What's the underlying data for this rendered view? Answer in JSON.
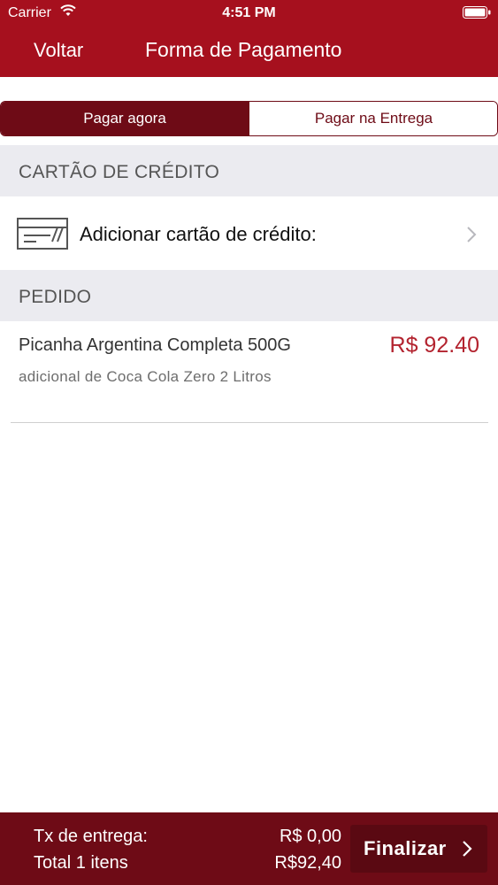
{
  "status_bar": {
    "carrier": "Carrier",
    "time": "4:51 PM"
  },
  "nav": {
    "back_label": "Voltar",
    "title": "Forma de Pagamento"
  },
  "payment_tabs": [
    {
      "label": "Pagar agora",
      "selected": true
    },
    {
      "label": "Pagar na Entrega",
      "selected": false
    }
  ],
  "credit_card_section": {
    "header": "CARTÃO DE CRÉDITO",
    "add_card_label": "Adicionar cartão de crédito:"
  },
  "order_section": {
    "header": "PEDIDO",
    "items": [
      {
        "name": "Picanha Argentina Completa 500G",
        "price": "R$ 92.40",
        "addon": "adicional de Coca Cola Zero 2 Litros"
      }
    ]
  },
  "footer": {
    "delivery_fee_label": "Tx de entrega:",
    "delivery_fee_value": "R$ 0,00",
    "total_label": "Total  1 itens",
    "total_value": "R$92,40",
    "finish_label": "Finalizar"
  },
  "colors": {
    "brand_red": "#a6101e",
    "dark_red": "#6e0b16",
    "price_red": "#b3232f",
    "section_bg": "#ebebf0"
  }
}
